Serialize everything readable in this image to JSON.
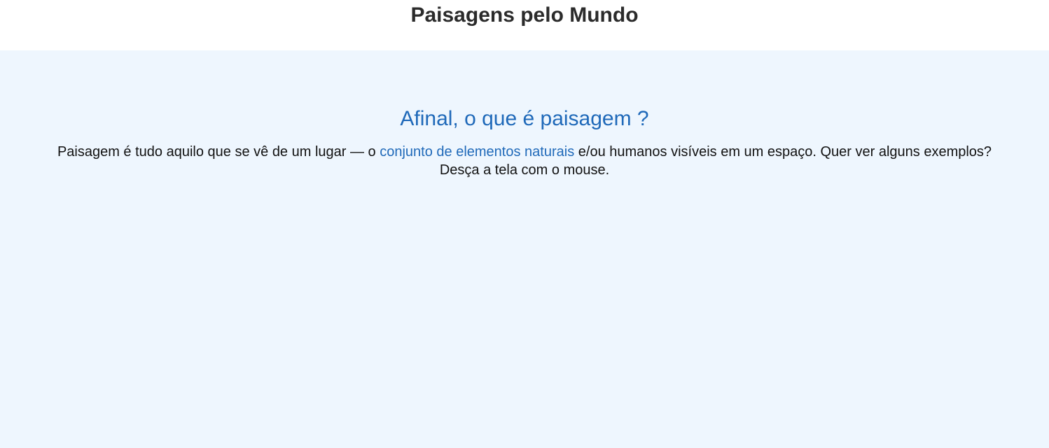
{
  "header": {
    "title": "Paisagens pelo Mundo"
  },
  "hero": {
    "heading": "Afinal, o que é paisagem ?",
    "text_before_link": "Paisagem é tudo aquilo que se vê de um lugar — o ",
    "link_text": "conjunto de elementos naturais",
    "text_after_link": " e/ou humanos visíveis em um espaço. Quer ver alguns exemplos? Desça a tela com o mouse."
  },
  "colors": {
    "title_text": "#2b2b2b",
    "accent_blue": "#1f69b9",
    "hero_background": "#eef6fe"
  }
}
